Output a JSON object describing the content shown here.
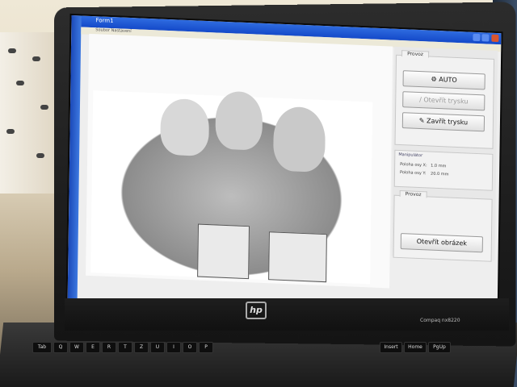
{
  "window": {
    "title": "Form1",
    "menu": "Soubor  Nastavení"
  },
  "panel": {
    "group_ovladani": {
      "tab": "Ovládání",
      "tab_inner": "Provoz",
      "auto_label": "AUTO",
      "open_nozzle_label": "Otevřít trysku",
      "close_nozzle_label": "Zavřít trysku"
    },
    "group_manipulator": {
      "title": "Manipulátor",
      "pos_x_label": "Poloha osy X:",
      "pos_x_value": "1.0 mm",
      "pos_y_label": "Poloha osy Y:",
      "pos_y_value": "20.0 mm"
    },
    "group_provoz": {
      "tab": "Provoz",
      "open_image_label": "Otevřít obrázek"
    }
  },
  "laptop": {
    "brand": "hp",
    "model": "Compaq nx8220"
  },
  "keyboard": {
    "keys": [
      "Tab",
      "Q",
      "W",
      "E",
      "R",
      "T",
      "Z",
      "U",
      "I",
      "O",
      "P",
      "Insert",
      "Home",
      "PgUp"
    ]
  }
}
